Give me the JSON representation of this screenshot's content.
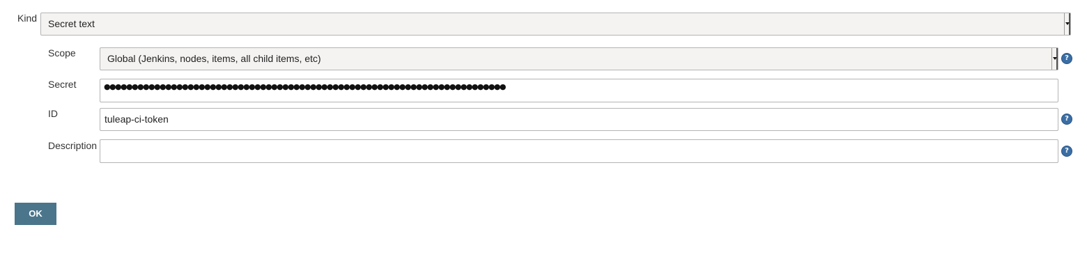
{
  "kind": {
    "label": "Kind",
    "value": "Secret text"
  },
  "scope": {
    "label": "Scope",
    "value": "Global (Jenkins, nodes, items, all child items, etc)"
  },
  "secret": {
    "label": "Secret",
    "masked_value": "●●●●●●●●●●●●●●●●●●●●●●●●●●●●●●●●●●●●●●●●●●●●●●●●●●●●●●●●●●●●●●●●●●●●●●●●"
  },
  "id": {
    "label": "ID",
    "value": "tuleap-ci-token"
  },
  "description": {
    "label": "Description",
    "value": ""
  },
  "help": {
    "glyph": "?"
  },
  "buttons": {
    "ok_label": "OK"
  },
  "colors": {
    "ok_button": "#4b758b",
    "help_icon": "#3a6ea5",
    "select_background": "#f4f3f1"
  }
}
